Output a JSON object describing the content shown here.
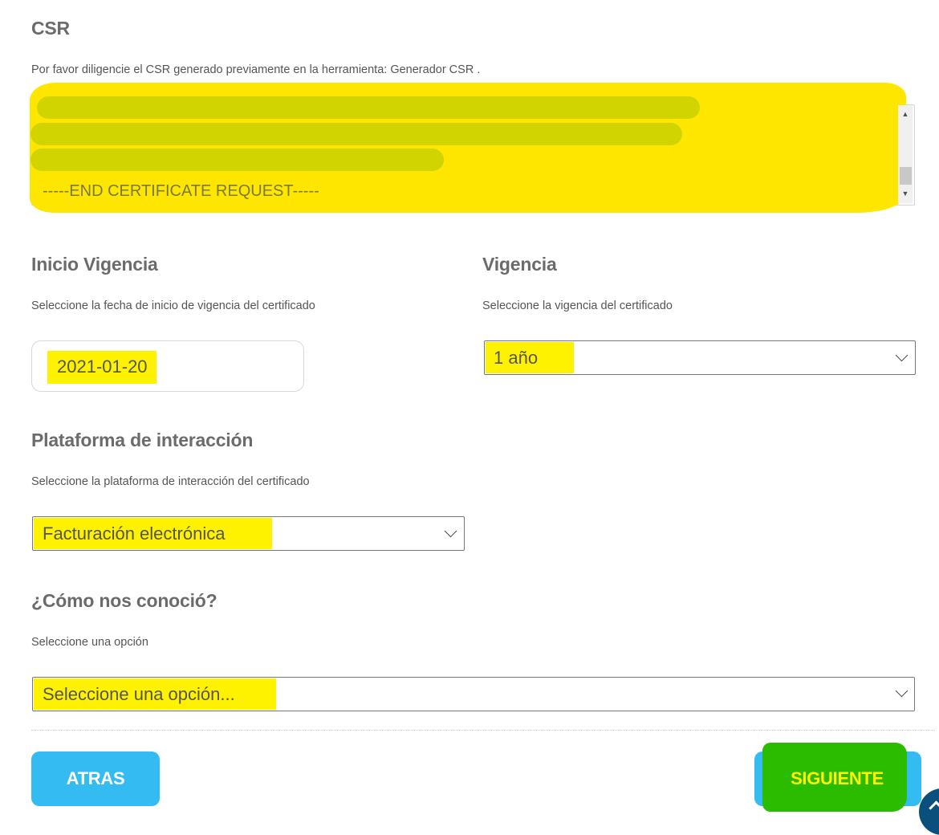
{
  "csr": {
    "title": "CSR",
    "helper": "Por favor diligencie el CSR generado previamente en la herramienta: Generador CSR .",
    "value_tail": "-----END CERTIFICATE REQUEST-----"
  },
  "inicio_vigencia": {
    "title": "Inicio Vigencia",
    "helper": "Seleccione la fecha de inicio de vigencia del certificado",
    "value": "2021-01-20"
  },
  "vigencia": {
    "title": "Vigencia",
    "helper": "Seleccione la vigencia del certificado",
    "selected": "1 año"
  },
  "plataforma": {
    "title": "Plataforma de interacción",
    "helper": "Seleccione la plataforma de interacción del certificado",
    "selected": "Facturación electrónica"
  },
  "como_nos_conocio": {
    "title": "¿Cómo nos conoció?",
    "helper": "Seleccione una opción",
    "selected": "Seleccione una opción..."
  },
  "buttons": {
    "back_label": "ATRAS",
    "next_label": "SIGUIENTE"
  },
  "icons": {
    "select_chevron": "chevron-down-icon",
    "scroll_top": "arrow-up-icon"
  },
  "colors": {
    "button_primary": "#33bbf2",
    "highlight": "#fff200",
    "next_button_overlay": "#2bbc00",
    "fab": "#0b4f7c"
  }
}
